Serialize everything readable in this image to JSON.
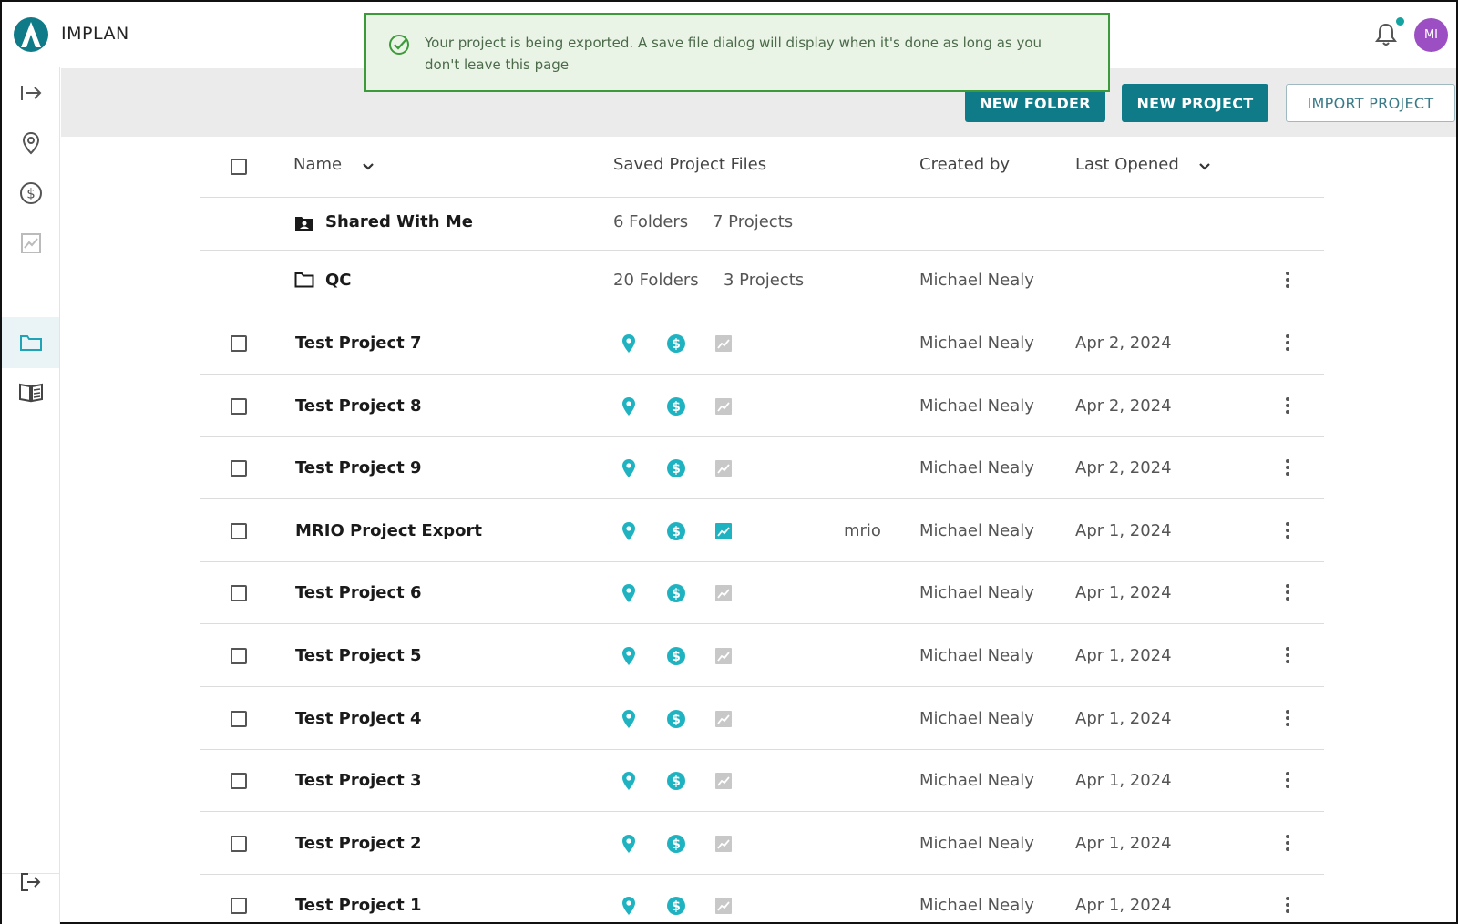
{
  "app": {
    "brand": "IMPLAN",
    "avatar_initials": "MI"
  },
  "colors": {
    "accent": "#0f7a88",
    "teal_icon": "#1fb3c1",
    "toast_border": "#3d9a3a",
    "avatar": "#9c4fc2"
  },
  "toast": {
    "message": "Your project is being exported. A save file dialog will display when it's done as long as you don't leave this page",
    "icon": "check-circle-icon"
  },
  "actions": {
    "new_folder": "NEW FOLDER",
    "new_project": "NEW PROJECT",
    "import_project": "IMPORT PROJECT"
  },
  "sidebar": {
    "icons": [
      "expand-arrow-icon",
      "location-pin-icon",
      "dollar-circle-icon",
      "chart-icon",
      "folder-icon",
      "book-icon",
      "logout-icon"
    ],
    "active": "folder-icon"
  },
  "table": {
    "headers": {
      "name": "Name",
      "saved_files": "Saved Project Files",
      "created_by": "Created by",
      "last_opened": "Last Opened"
    },
    "folders": [
      {
        "name": "Shared With Me",
        "icon": "shared-folder-icon",
        "folders": "6 Folders",
        "projects": "7 Projects",
        "created_by": ""
      },
      {
        "name": "QC",
        "icon": "folder-icon",
        "folders": "20 Folders",
        "projects": "3 Projects",
        "created_by": "Michael Nealy"
      }
    ],
    "projects": [
      {
        "name": "Test Project 7",
        "tag": "",
        "created_by": "Michael Nealy",
        "last_opened": "Apr 2, 2024",
        "chart_active": false
      },
      {
        "name": "Test Project 8",
        "tag": "",
        "created_by": "Michael Nealy",
        "last_opened": "Apr 2, 2024",
        "chart_active": false
      },
      {
        "name": "Test Project 9",
        "tag": "",
        "created_by": "Michael Nealy",
        "last_opened": "Apr 2, 2024",
        "chart_active": false
      },
      {
        "name": "MRIO Project Export",
        "tag": "mrio",
        "created_by": "Michael Nealy",
        "last_opened": "Apr 1, 2024",
        "chart_active": true
      },
      {
        "name": "Test Project 6",
        "tag": "",
        "created_by": "Michael Nealy",
        "last_opened": "Apr 1, 2024",
        "chart_active": false
      },
      {
        "name": "Test Project 5",
        "tag": "",
        "created_by": "Michael Nealy",
        "last_opened": "Apr 1, 2024",
        "chart_active": false
      },
      {
        "name": "Test Project 4",
        "tag": "",
        "created_by": "Michael Nealy",
        "last_opened": "Apr 1, 2024",
        "chart_active": false
      },
      {
        "name": "Test Project 3",
        "tag": "",
        "created_by": "Michael Nealy",
        "last_opened": "Apr 1, 2024",
        "chart_active": false
      },
      {
        "name": "Test Project 2",
        "tag": "",
        "created_by": "Michael Nealy",
        "last_opened": "Apr 1, 2024",
        "chart_active": false
      },
      {
        "name": "Test Project 1",
        "tag": "",
        "created_by": "Michael Nealy",
        "last_opened": "Apr 1, 2024",
        "chart_active": false
      }
    ]
  }
}
